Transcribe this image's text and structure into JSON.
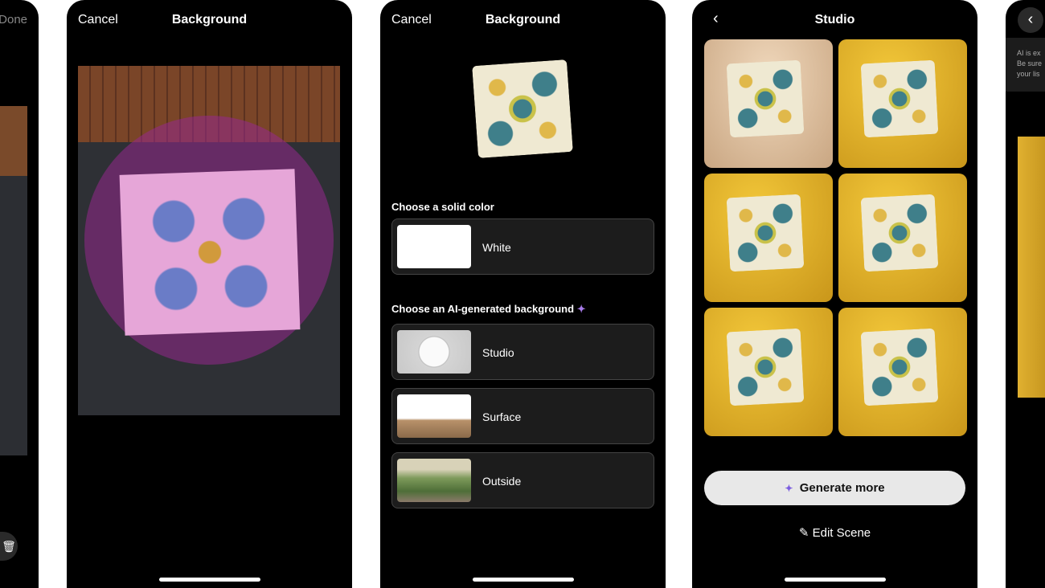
{
  "screen1": {
    "done_label": "Done",
    "trash_icon": "trash-icon"
  },
  "screen2": {
    "cancel_label": "Cancel",
    "title": "Background"
  },
  "screen3": {
    "cancel_label": "Cancel",
    "title": "Background",
    "solid_heading": "Choose a solid color",
    "solid_options": [
      {
        "label": "White"
      }
    ],
    "ai_heading": "Choose an AI-generated background",
    "ai_icon": "sparkle-icon",
    "ai_options": [
      {
        "label": "Studio"
      },
      {
        "label": "Surface"
      },
      {
        "label": "Outside"
      }
    ]
  },
  "screen4": {
    "title": "Studio",
    "back_icon": "chevron-left-icon",
    "generate_label": "Generate more",
    "edit_label": "Edit Scene"
  },
  "screen5": {
    "notice": "AI is ex\nBe sure\nyour lis"
  },
  "colors": {
    "background": "#000000",
    "card": "#1c1c1c",
    "button": "#e8e8e8"
  }
}
